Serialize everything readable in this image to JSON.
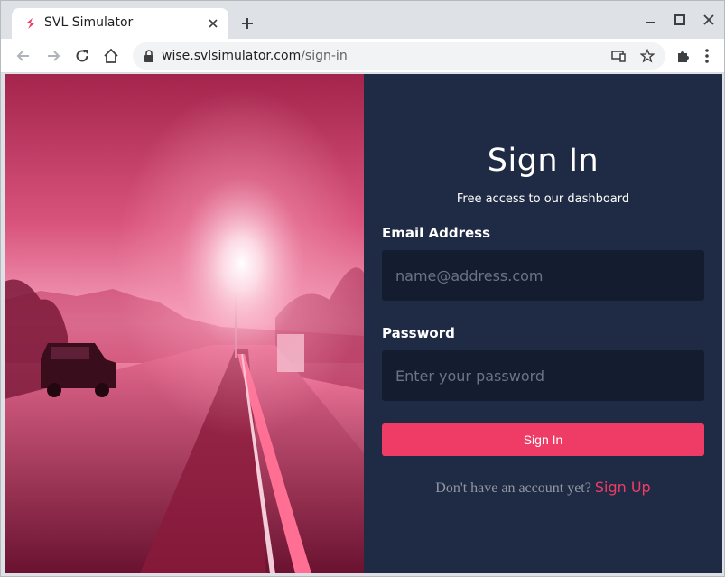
{
  "browser": {
    "tab_title": "SVL Simulator",
    "url_host": "wise.svlsimulator.com",
    "url_path": "/sign-in"
  },
  "colors": {
    "brand": "#ee3c67",
    "panel_bg": "#1f2b44",
    "input_bg": "#141c2f"
  },
  "icons": {
    "favicon": "svl-logo-icon",
    "tab_close": "close-icon",
    "new_tab": "plus-icon",
    "minimize": "minimize-icon",
    "maximize": "maximize-icon",
    "close": "close-icon",
    "back": "arrow-left-icon",
    "forward": "arrow-right-icon",
    "reload": "reload-icon",
    "home": "home-icon",
    "lock": "lock-icon",
    "cast": "cast-icon",
    "bookmark": "star-icon",
    "extensions": "puzzle-icon",
    "menu": "kebab-menu-icon"
  },
  "hero": {
    "image": "pink sunset road scene with car"
  },
  "signin": {
    "title": "Sign In",
    "subtitle": "Free access to our dashboard",
    "email_label": "Email Address",
    "email_placeholder": "name@address.com",
    "email_value": "",
    "password_label": "Password",
    "password_placeholder": "Enter your password",
    "password_value": "",
    "button_label": "Sign In",
    "no_account_text": "Don't have an account yet?",
    "signup_link": "Sign Up"
  }
}
